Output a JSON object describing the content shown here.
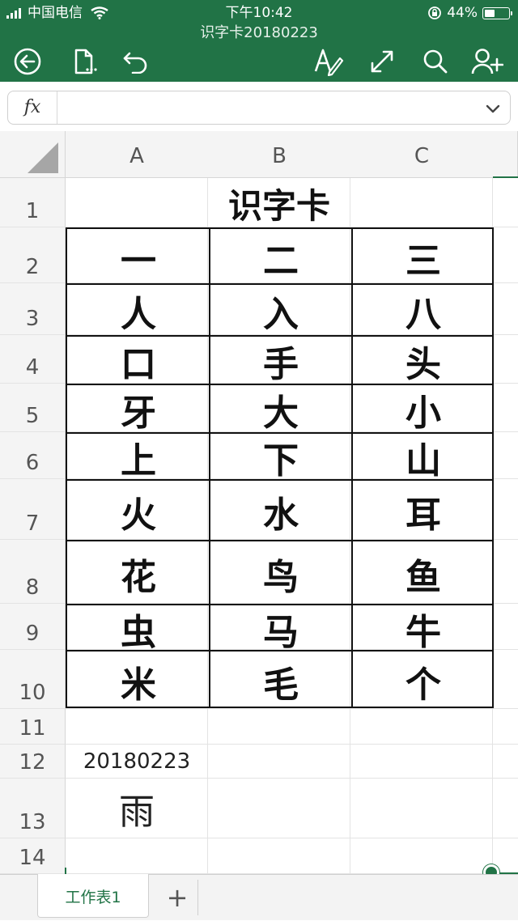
{
  "status_bar": {
    "carrier": "中国电信",
    "time": "下午10:42",
    "battery": "44%",
    "battery_level": 0.44
  },
  "document": {
    "title": "识字卡20180223"
  },
  "toolbar": {
    "icons": [
      "back-icon",
      "file-icon",
      "undo-icon",
      "format-text-icon",
      "fullscreen-icon",
      "search-icon",
      "add-person-icon"
    ]
  },
  "formula_bar": {
    "label": "fx",
    "value": ""
  },
  "columns": [
    "A",
    "B",
    "C"
  ],
  "rows": [
    "1",
    "2",
    "3",
    "4",
    "5",
    "6",
    "7",
    "8",
    "9",
    "10",
    "11",
    "12",
    "13",
    "14"
  ],
  "sheet": {
    "title": "识字卡",
    "chars": [
      [
        "一",
        "二",
        "三"
      ],
      [
        "人",
        "入",
        "八"
      ],
      [
        "口",
        "手",
        "头"
      ],
      [
        "牙",
        "大",
        "小"
      ],
      [
        "上",
        "下",
        "山"
      ],
      [
        "火",
        "水",
        "耳"
      ],
      [
        "花",
        "鸟",
        "鱼"
      ],
      [
        "虫",
        "马",
        "牛"
      ],
      [
        "米",
        "毛",
        "个"
      ]
    ],
    "date": "20180223",
    "extra_char": "雨"
  },
  "tabs": {
    "sheet1": "工作表1",
    "add": "+"
  },
  "colors": {
    "accent": "#217346"
  }
}
